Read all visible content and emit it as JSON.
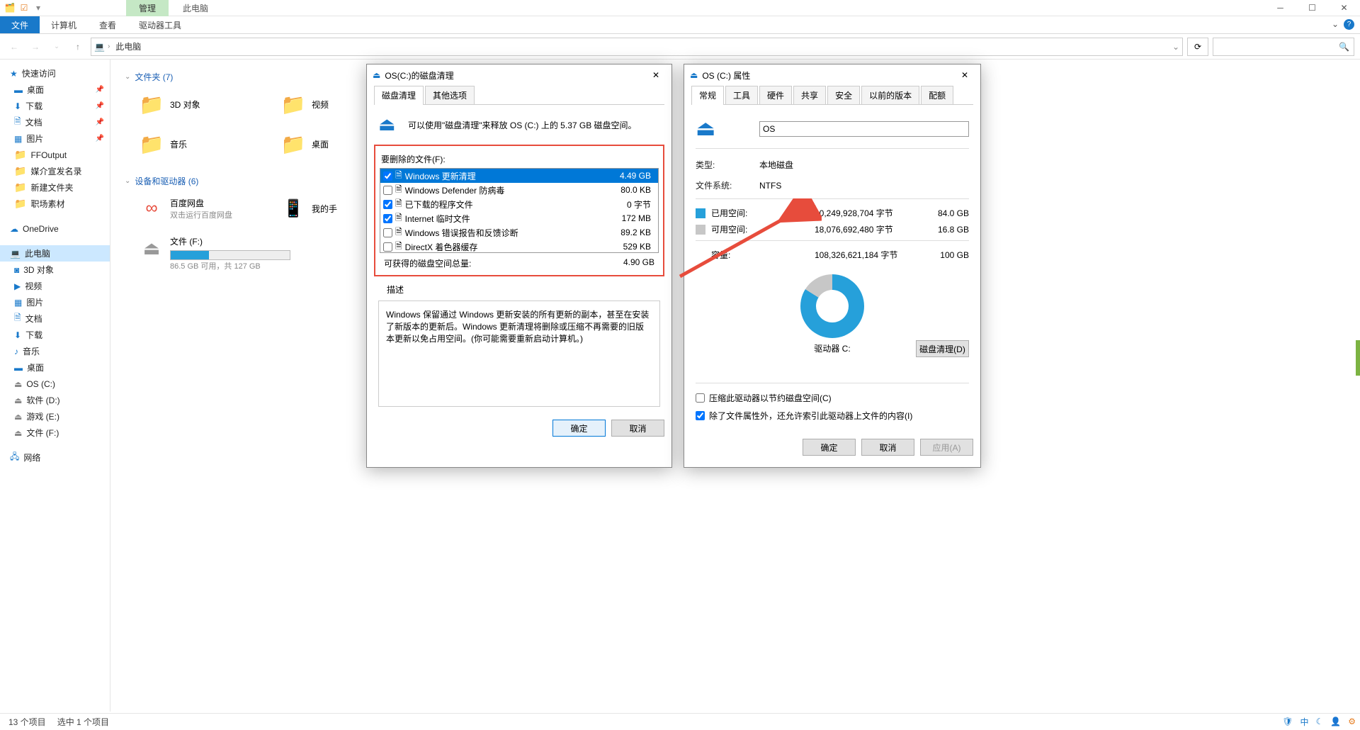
{
  "titlebar": {
    "manage": "管理",
    "title": "此电脑"
  },
  "ribbon": {
    "file": "文件",
    "computer": "计算机",
    "view": "查看",
    "drivetools": "驱动器工具"
  },
  "nav": {
    "location": "此电脑"
  },
  "sidebar": {
    "quick": "快速访问",
    "desktop": "桌面",
    "downloads": "下载",
    "documents": "文档",
    "pictures": "图片",
    "ffoutput": "FFOutput",
    "media": "媒介宣发名录",
    "newfolder": "新建文件夹",
    "workplace": "职场素材",
    "onedrive": "OneDrive",
    "thispc": "此电脑",
    "obj3d": "3D 对象",
    "video": "视频",
    "music": "音乐",
    "osc": "OS (C:)",
    "soft": "软件 (D:)",
    "game": "游戏 (E:)",
    "filef": "文件 (F:)",
    "network": "网络"
  },
  "content": {
    "folders_hdr": "文件夹 (7)",
    "devices_hdr": "设备和驱动器 (6)",
    "obj3d": "3D 对象",
    "video": "视频",
    "music": "音乐",
    "desktop": "桌面",
    "baidu": "百度网盘",
    "baidu_sub": "双击运行百度网盘",
    "phone": "我的手",
    "filef": "文件 (F:)",
    "filef_sub": "86.5 GB 可用，共 127 GB"
  },
  "cleanup": {
    "title": "OS(C:)的磁盘清理",
    "tab1": "磁盘清理",
    "tab2": "其他选项",
    "info": "可以使用\"磁盘清理\"来释放 OS (C:) 上的 5.37 GB 磁盘空间。",
    "files_label": "要删除的文件(F):",
    "items": [
      {
        "name": "Windows 更新清理",
        "size": "4.49 GB",
        "checked": true,
        "selected": true
      },
      {
        "name": "Windows Defender 防病毒",
        "size": "80.0 KB",
        "checked": false
      },
      {
        "name": "已下载的程序文件",
        "size": "0 字节",
        "checked": true
      },
      {
        "name": "Internet 临时文件",
        "size": "172 MB",
        "checked": true
      },
      {
        "name": "Windows 错误报告和反馈诊断",
        "size": "89.2 KB",
        "checked": false
      },
      {
        "name": "DirectX 着色器缓存",
        "size": "529 KB",
        "checked": false
      }
    ],
    "total_label": "可获得的磁盘空间总量:",
    "total_value": "4.90 GB",
    "desc_label": "描述",
    "desc": "Windows 保留通过 Windows 更新安装的所有更新的副本，甚至在安装了新版本的更新后。Windows 更新清理将删除或压缩不再需要的旧版本更新以免占用空间。(你可能需要重新启动计算机。)",
    "ok": "确定",
    "cancel": "取消"
  },
  "props": {
    "title": "OS (C:) 属性",
    "tabs": [
      "常规",
      "工具",
      "硬件",
      "共享",
      "安全",
      "以前的版本",
      "配额"
    ],
    "volname": "OS",
    "type_k": "类型:",
    "type_v": "本地磁盘",
    "fs_k": "文件系统:",
    "fs_v": "NTFS",
    "used_k": "已用空间:",
    "used_bytes": "90,249,928,704 字节",
    "used_gb": "84.0 GB",
    "free_k": "可用空间:",
    "free_bytes": "18,076,692,480 字节",
    "free_gb": "16.8 GB",
    "cap_k": "容量:",
    "cap_bytes": "108,326,621,184 字节",
    "cap_gb": "100 GB",
    "drive_label": "驱动器 C:",
    "cleanup_btn": "磁盘清理(D)",
    "compress": "压缩此驱动器以节约磁盘空间(C)",
    "index": "除了文件属性外，还允许索引此驱动器上文件的内容(I)",
    "ok": "确定",
    "cancel": "取消",
    "apply": "应用(A)"
  },
  "status": {
    "items": "13 个项目",
    "selected": "选中 1 个项目"
  },
  "tray": {
    "ime": "中"
  }
}
